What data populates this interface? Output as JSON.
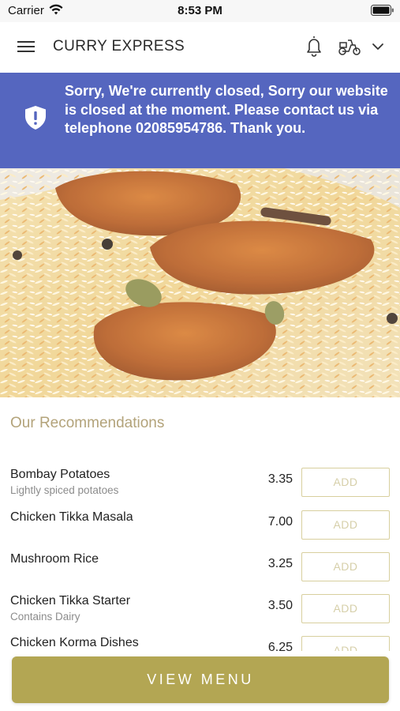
{
  "status_bar": {
    "carrier": "Carrier",
    "time": "8:53 PM"
  },
  "header": {
    "title": "CURRY EXPRESS",
    "icons": [
      "menu-icon",
      "bell-icon",
      "scooter-icon",
      "chevron-down-icon"
    ]
  },
  "banner": {
    "text": "Sorry, We're currently closed, Sorry our website is closed at the moment. Please contact us via telephone 02085954786. Thank you.",
    "color": "#5566bf",
    "icon": "shield-icon"
  },
  "hero": {
    "icon": "biryani-photo"
  },
  "recommendations": {
    "title": "Our Recommendations",
    "items": [
      {
        "name": "Bombay Potatoes",
        "desc": "Lightly spiced potatoes",
        "price": "3.35",
        "add": "ADD"
      },
      {
        "name": "Chicken Tikka Masala",
        "desc": "",
        "price": "7.00",
        "add": "ADD"
      },
      {
        "name": "Mushroom Rice",
        "desc": "",
        "price": "3.25",
        "add": "ADD"
      },
      {
        "name": "Chicken Tikka Starter",
        "desc": "Contains Dairy",
        "price": "3.50",
        "add": "ADD"
      },
      {
        "name": "Chicken Korma Dishes",
        "desc": "",
        "price": "6.25",
        "add": "ADD"
      }
    ]
  },
  "footer": {
    "view_menu": "VIEW MENU",
    "accent": "#b3a653"
  }
}
